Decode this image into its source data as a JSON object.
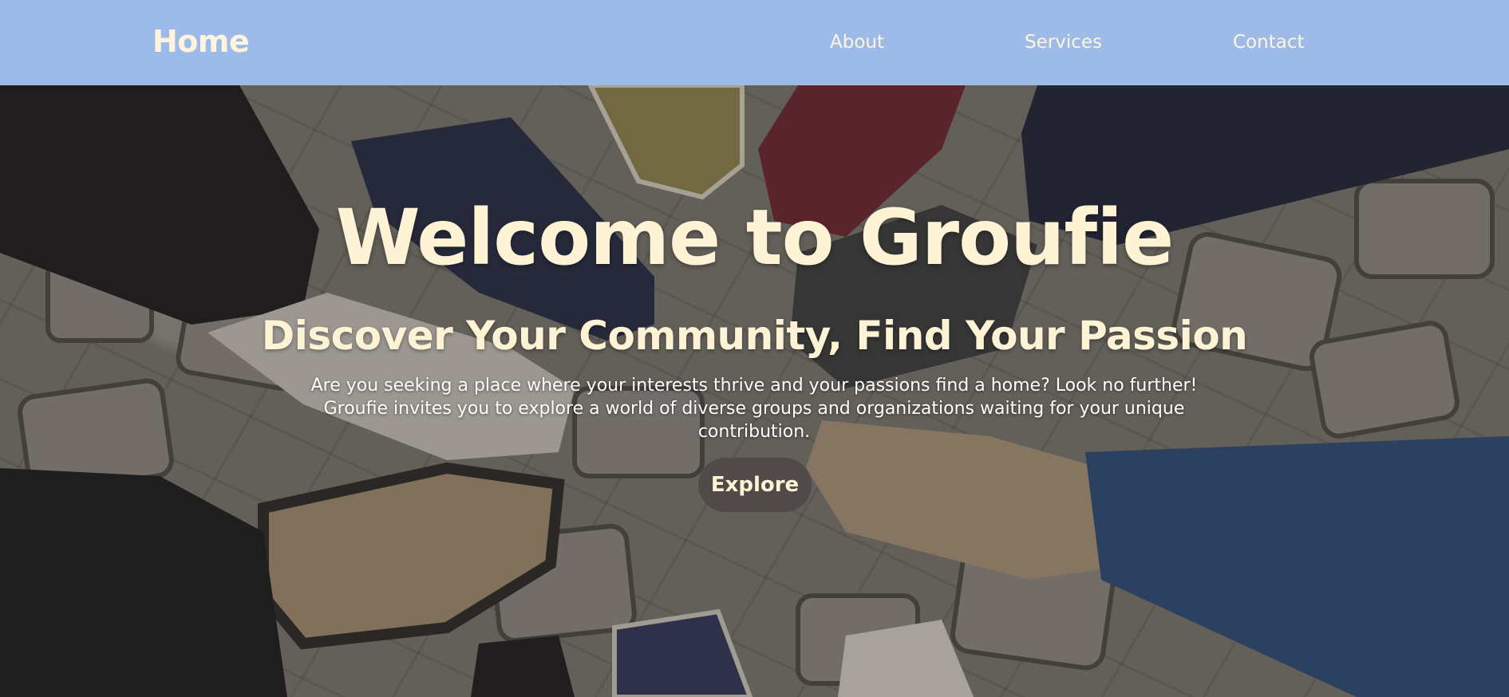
{
  "nav": {
    "home_label": "Home",
    "links": [
      {
        "label": "About"
      },
      {
        "label": "Services"
      },
      {
        "label": "Contact"
      }
    ]
  },
  "hero": {
    "title": "Welcome to Groufie",
    "subtitle": "Discover Your Community, Find Your Passion",
    "description": "Are you seeking a place where your interests thrive and your passions find a home? Look no further! Groufie invites you to explore a world of diverse groups and organizations waiting for your unique contribution.",
    "button_label": "Explore",
    "background_image": "shoes-circle-on-cobblestone-photo"
  },
  "colors": {
    "nav_background": "#9cbbe8",
    "nav_text": "#fff5df",
    "hero_text": "#fff3d6",
    "button_background": "#504a48"
  }
}
